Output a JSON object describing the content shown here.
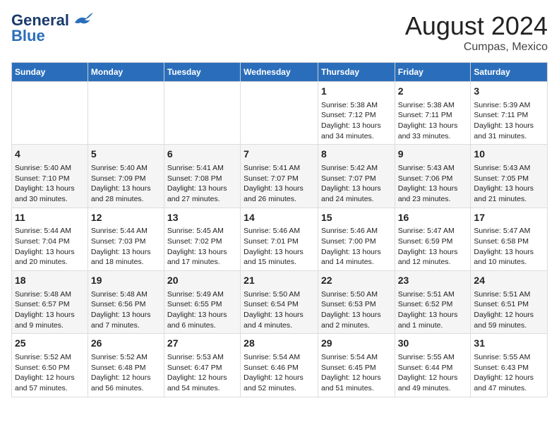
{
  "header": {
    "logo_line1": "General",
    "logo_line2": "Blue",
    "title": "August 2024",
    "subtitle": "Cumpas, Mexico"
  },
  "days_of_week": [
    "Sunday",
    "Monday",
    "Tuesday",
    "Wednesday",
    "Thursday",
    "Friday",
    "Saturday"
  ],
  "weeks": [
    [
      {
        "day": "",
        "content": ""
      },
      {
        "day": "",
        "content": ""
      },
      {
        "day": "",
        "content": ""
      },
      {
        "day": "",
        "content": ""
      },
      {
        "day": "1",
        "sunrise": "5:38 AM",
        "sunset": "7:12 PM",
        "daylight": "13 hours and 34 minutes."
      },
      {
        "day": "2",
        "sunrise": "5:38 AM",
        "sunset": "7:11 PM",
        "daylight": "13 hours and 33 minutes."
      },
      {
        "day": "3",
        "sunrise": "5:39 AM",
        "sunset": "7:11 PM",
        "daylight": "13 hours and 31 minutes."
      }
    ],
    [
      {
        "day": "4",
        "sunrise": "5:40 AM",
        "sunset": "7:10 PM",
        "daylight": "13 hours and 30 minutes."
      },
      {
        "day": "5",
        "sunrise": "5:40 AM",
        "sunset": "7:09 PM",
        "daylight": "13 hours and 28 minutes."
      },
      {
        "day": "6",
        "sunrise": "5:41 AM",
        "sunset": "7:08 PM",
        "daylight": "13 hours and 27 minutes."
      },
      {
        "day": "7",
        "sunrise": "5:41 AM",
        "sunset": "7:07 PM",
        "daylight": "13 hours and 26 minutes."
      },
      {
        "day": "8",
        "sunrise": "5:42 AM",
        "sunset": "7:07 PM",
        "daylight": "13 hours and 24 minutes."
      },
      {
        "day": "9",
        "sunrise": "5:43 AM",
        "sunset": "7:06 PM",
        "daylight": "13 hours and 23 minutes."
      },
      {
        "day": "10",
        "sunrise": "5:43 AM",
        "sunset": "7:05 PM",
        "daylight": "13 hours and 21 minutes."
      }
    ],
    [
      {
        "day": "11",
        "sunrise": "5:44 AM",
        "sunset": "7:04 PM",
        "daylight": "13 hours and 20 minutes."
      },
      {
        "day": "12",
        "sunrise": "5:44 AM",
        "sunset": "7:03 PM",
        "daylight": "13 hours and 18 minutes."
      },
      {
        "day": "13",
        "sunrise": "5:45 AM",
        "sunset": "7:02 PM",
        "daylight": "13 hours and 17 minutes."
      },
      {
        "day": "14",
        "sunrise": "5:46 AM",
        "sunset": "7:01 PM",
        "daylight": "13 hours and 15 minutes."
      },
      {
        "day": "15",
        "sunrise": "5:46 AM",
        "sunset": "7:00 PM",
        "daylight": "13 hours and 14 minutes."
      },
      {
        "day": "16",
        "sunrise": "5:47 AM",
        "sunset": "6:59 PM",
        "daylight": "13 hours and 12 minutes."
      },
      {
        "day": "17",
        "sunrise": "5:47 AM",
        "sunset": "6:58 PM",
        "daylight": "13 hours and 10 minutes."
      }
    ],
    [
      {
        "day": "18",
        "sunrise": "5:48 AM",
        "sunset": "6:57 PM",
        "daylight": "13 hours and 9 minutes."
      },
      {
        "day": "19",
        "sunrise": "5:48 AM",
        "sunset": "6:56 PM",
        "daylight": "13 hours and 7 minutes."
      },
      {
        "day": "20",
        "sunrise": "5:49 AM",
        "sunset": "6:55 PM",
        "daylight": "13 hours and 6 minutes."
      },
      {
        "day": "21",
        "sunrise": "5:50 AM",
        "sunset": "6:54 PM",
        "daylight": "13 hours and 4 minutes."
      },
      {
        "day": "22",
        "sunrise": "5:50 AM",
        "sunset": "6:53 PM",
        "daylight": "13 hours and 2 minutes."
      },
      {
        "day": "23",
        "sunrise": "5:51 AM",
        "sunset": "6:52 PM",
        "daylight": "13 hours and 1 minute."
      },
      {
        "day": "24",
        "sunrise": "5:51 AM",
        "sunset": "6:51 PM",
        "daylight": "12 hours and 59 minutes."
      }
    ],
    [
      {
        "day": "25",
        "sunrise": "5:52 AM",
        "sunset": "6:50 PM",
        "daylight": "12 hours and 57 minutes."
      },
      {
        "day": "26",
        "sunrise": "5:52 AM",
        "sunset": "6:48 PM",
        "daylight": "12 hours and 56 minutes."
      },
      {
        "day": "27",
        "sunrise": "5:53 AM",
        "sunset": "6:47 PM",
        "daylight": "12 hours and 54 minutes."
      },
      {
        "day": "28",
        "sunrise": "5:54 AM",
        "sunset": "6:46 PM",
        "daylight": "12 hours and 52 minutes."
      },
      {
        "day": "29",
        "sunrise": "5:54 AM",
        "sunset": "6:45 PM",
        "daylight": "12 hours and 51 minutes."
      },
      {
        "day": "30",
        "sunrise": "5:55 AM",
        "sunset": "6:44 PM",
        "daylight": "12 hours and 49 minutes."
      },
      {
        "day": "31",
        "sunrise": "5:55 AM",
        "sunset": "6:43 PM",
        "daylight": "12 hours and 47 minutes."
      }
    ]
  ]
}
